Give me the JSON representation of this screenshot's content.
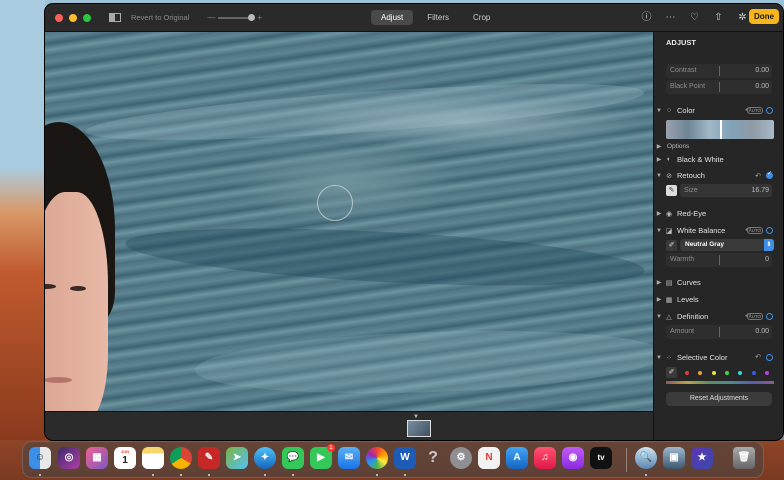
{
  "window": {
    "revert_label": "Revert to Original",
    "zoom_minus": "—",
    "zoom_plus": "+",
    "tabs": [
      {
        "label": "Adjust",
        "active": true
      },
      {
        "label": "Filters",
        "active": false
      },
      {
        "label": "Crop",
        "active": false
      }
    ],
    "done_label": "Done",
    "icons": [
      "info-icon",
      "more-icon",
      "favorite-icon",
      "share-icon",
      "magic-wand-icon"
    ]
  },
  "sidebar": {
    "title": "ADJUST",
    "light": {
      "contrast_label": "Contrast",
      "contrast_value": "0.00",
      "blackpoint_label": "Black Point",
      "blackpoint_value": "0.00"
    },
    "color": {
      "label": "Color",
      "auto": "AUTO",
      "options_label": "Options"
    },
    "bw": {
      "label": "Black & White"
    },
    "retouch": {
      "label": "Retouch",
      "size_label": "Size",
      "size_value": "16.79"
    },
    "redeye": {
      "label": "Red-Eye"
    },
    "white_balance": {
      "label": "White Balance",
      "auto": "AUTO",
      "preset": "Neutral Gray",
      "warmth_label": "Warmth",
      "warmth_value": "0"
    },
    "curves": {
      "label": "Curves"
    },
    "levels": {
      "label": "Levels"
    },
    "definition": {
      "label": "Definition",
      "auto": "AUTO",
      "amount_label": "Amount",
      "amount_value": "0.00"
    },
    "selective_color": {
      "label": "Selective Color"
    },
    "reset_label": "Reset Adjustments"
  },
  "dock": {
    "calendar_month": "JUN",
    "calendar_day": "1",
    "facetime_badge": "1",
    "help_glyph": "?",
    "appletv_label": "tv"
  },
  "colors": {
    "accent": "#3d8ee8",
    "done": "#f5b51b"
  }
}
